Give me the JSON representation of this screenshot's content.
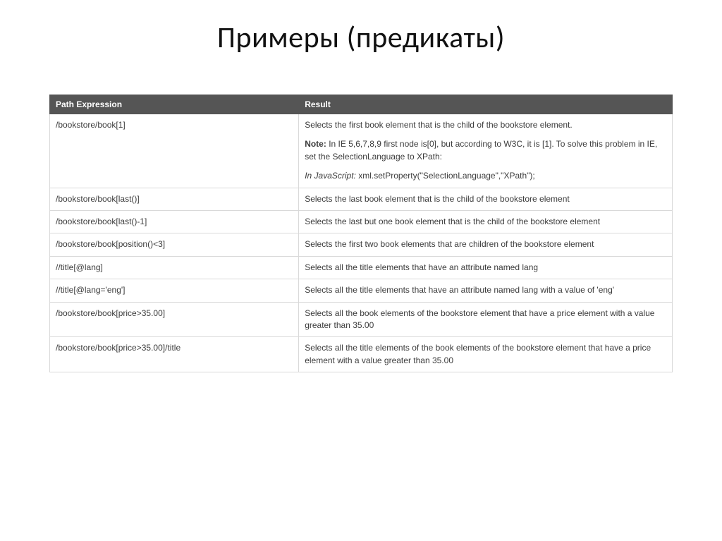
{
  "title": "Примеры (предикаты)",
  "table": {
    "headers": {
      "expr": "Path Expression",
      "result": "Result"
    },
    "rows": [
      {
        "expr": "/bookstore/book[1]",
        "result": "Selects the first book element that is the child of the bookstore element.",
        "note_label": "Note:",
        "note_text": " In IE 5,6,7,8,9 first node is[0], but according to W3C, it is [1]. To solve this problem in IE, set the SelectionLanguage to XPath:",
        "code_prefix": "In JavaScript:",
        "code_rest": " xml.setProperty(\"SelectionLanguage\",\"XPath\");"
      },
      {
        "expr": "/bookstore/book[last()]",
        "result": "Selects the last book element that is the child of the bookstore element"
      },
      {
        "expr": "/bookstore/book[last()-1]",
        "result": "Selects the last but one book element that is the child of the bookstore element"
      },
      {
        "expr": "/bookstore/book[position()<3]",
        "result": "Selects the first two book elements that are children of the bookstore element"
      },
      {
        "expr": "//title[@lang]",
        "result": "Selects all the title elements that have an attribute named lang"
      },
      {
        "expr": "//title[@lang='eng']",
        "result": "Selects all the title elements that have an attribute named lang with a value of 'eng'"
      },
      {
        "expr": "/bookstore/book[price>35.00]",
        "result": "Selects all the book elements of the bookstore element that have a price element with a value greater than 35.00"
      },
      {
        "expr": "/bookstore/book[price>35.00]/title",
        "result": "Selects all the title elements of the book elements of the bookstore element that have a price element with a value greater than 35.00"
      }
    ]
  }
}
